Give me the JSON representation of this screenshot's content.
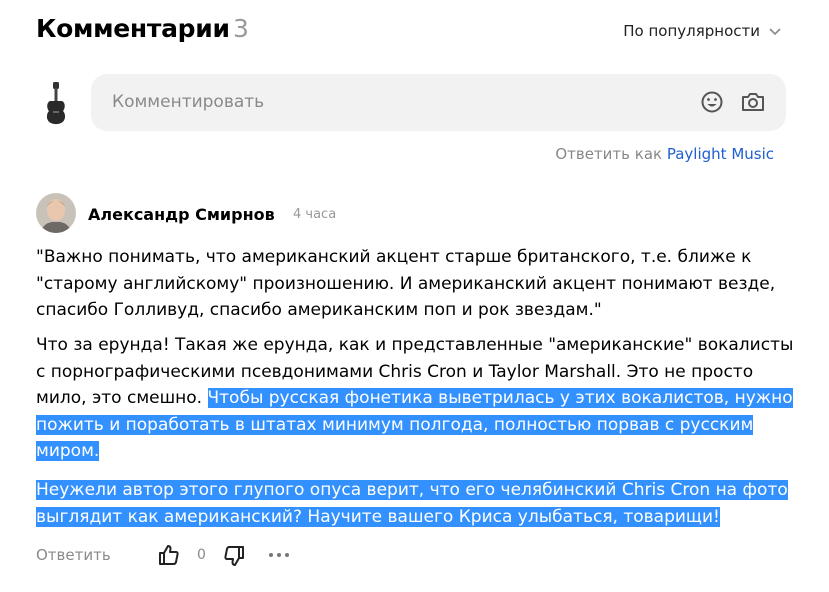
{
  "header": {
    "title": "Комментарии",
    "count": "3",
    "sort_label": "По популярности"
  },
  "composer": {
    "placeholder": "Комментировать",
    "avatar_icon": "guitar-icon",
    "emoji_icon": "smile-icon",
    "photo_icon": "camera-icon"
  },
  "reply_as": {
    "prefix": "Ответить как",
    "account": "Paylight Music"
  },
  "comment": {
    "author": "Александр Смирнов",
    "time": "4 часа",
    "paragraph1": "\"Важно понимать, что американский акцент старше британского, т.е. ближе к \"старому английскому\" произношению. И американский акцент понимают везде, спасибо Голливуд, спасибо американским поп и рок звездам.\"",
    "paragraph2_plain": "Что за ерунда! Такая же ерунда, как и представленные \"американские\" вокалисты с порнографическими псевдонимами Chris Cron и Taylor Marshall. Это не просто мило, это смешно. ",
    "paragraph2_selected": "Чтобы русская фонетика выветрилась у этих вокалистов, нужно пожить и поработать в штатах минимум полгода, полностью порвав с русским миром.",
    "paragraph3_selected": "Неужели автор этого глупого опуса верит, что его челябинский Chris Cron на фото выглядит как американский? Научите вашего Криса улыбаться, товарищи!",
    "actions": {
      "reply_label": "Ответить",
      "likes": "0"
    }
  },
  "colors": {
    "selection": "#3391ff",
    "link": "#1f5fd1",
    "composer_bg": "#f2f2f3"
  }
}
